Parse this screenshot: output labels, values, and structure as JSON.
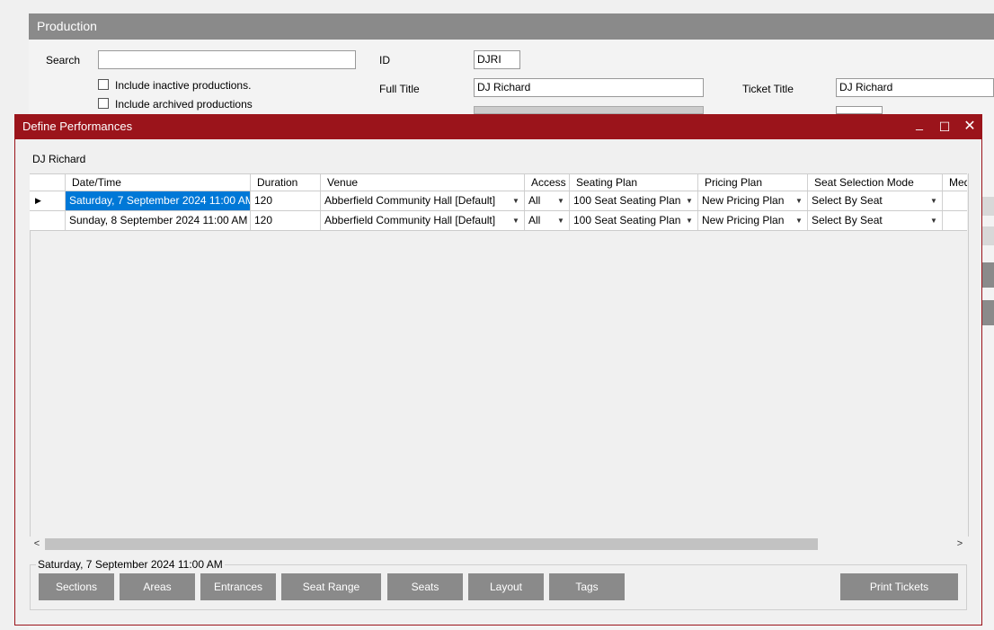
{
  "production": {
    "header": "Production",
    "search_label": "Search",
    "search_value": "",
    "include_inactive": "Include inactive productions.",
    "include_archived": "Include archived productions",
    "id_label": "ID",
    "id_value": "DJRI",
    "full_title_label": "Full Title",
    "full_title_value": "DJ Richard",
    "ticket_title_label": "Ticket Title",
    "ticket_title_value": "DJ Richard"
  },
  "dialog": {
    "title": "Define Performances",
    "minimize_glyph": "_",
    "maximize_glyph": "☐",
    "close_glyph": "✕",
    "production_name": "DJ Richard",
    "columns": [
      "Date/Time",
      "Duration",
      "Venue",
      "Access",
      "Seating Plan",
      "Pricing Plan",
      "Seat Selection Mode",
      "Med"
    ],
    "rows": [
      {
        "datetime": "Saturday, 7 September 2024 11:00 AM",
        "duration": "120",
        "venue": "Abberfield Community Hall [Default]",
        "access": "All",
        "seating_plan": "100 Seat Seating Plan",
        "pricing_plan": "New Pricing Plan",
        "seat_selection_mode": "Select By Seat",
        "media": ""
      },
      {
        "datetime": "Sunday, 8 September 2024 11:00 AM",
        "duration": "120",
        "venue": "Abberfield Community Hall [Default]",
        "access": "All",
        "seating_plan": "100 Seat Seating Plan",
        "pricing_plan": "New Pricing Plan",
        "seat_selection_mode": "Select By Seat",
        "media": ""
      }
    ],
    "selected_row_glyph": "▶",
    "selected_performance": "Saturday, 7 September 2024 11:00 AM",
    "buttons": {
      "sections": "Sections",
      "areas": "Areas",
      "entrances": "Entrances",
      "seat_range": "Seat Range",
      "seats": "Seats",
      "layout": "Layout",
      "tags": "Tags",
      "print_tickets": "Print Tickets"
    }
  },
  "colors": {
    "dialog_titlebar": "#9b141b",
    "production_header": "#8a8a8a",
    "button_bg": "#8a8a8a",
    "selection": "#0078d7"
  }
}
